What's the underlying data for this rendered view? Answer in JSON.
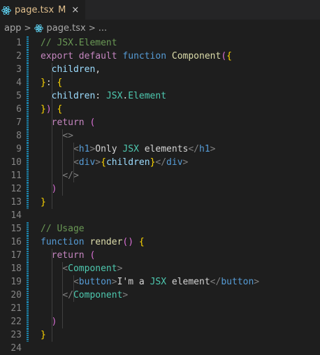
{
  "tab": {
    "filename": "page.tsx",
    "badge": "M",
    "close": "×",
    "icon": "react-icon"
  },
  "breadcrumb": {
    "segments": [
      "app",
      "page.tsx",
      "..."
    ],
    "separator": ">"
  },
  "editor": {
    "lines": [
      {
        "n": "1",
        "code": "// JSX.Element"
      },
      {
        "n": "2",
        "code": "export default function Component({"
      },
      {
        "n": "3",
        "code": "  children,"
      },
      {
        "n": "4",
        "code": "}: {"
      },
      {
        "n": "5",
        "code": "  children: JSX.Element"
      },
      {
        "n": "6",
        "code": "}) {"
      },
      {
        "n": "7",
        "code": "  return ("
      },
      {
        "n": "8",
        "code": "    <>"
      },
      {
        "n": "9",
        "code": "      <h1>Only JSX elements</h1>"
      },
      {
        "n": "10",
        "code": "      <div>{children}</div>"
      },
      {
        "n": "11",
        "code": "    </>"
      },
      {
        "n": "12",
        "code": "  )"
      },
      {
        "n": "13",
        "code": "}"
      },
      {
        "n": "14",
        "code": ""
      },
      {
        "n": "15",
        "code": "// Usage"
      },
      {
        "n": "16",
        "code": "function render() {"
      },
      {
        "n": "17",
        "code": "  return ("
      },
      {
        "n": "18",
        "code": "    <Component>"
      },
      {
        "n": "19",
        "code": "      <button>I'm a JSX element</button>"
      },
      {
        "n": "20",
        "code": "    </Component>"
      },
      {
        "n": "21",
        "code": ""
      },
      {
        "n": "22",
        "code": "  )"
      },
      {
        "n": "23",
        "code": "}"
      },
      {
        "n": "24",
        "code": ""
      }
    ]
  },
  "colors": {
    "background": "#1e1e1e",
    "tab_modified": "#e2c08d",
    "gutter_modified": "#1b81a8",
    "keyword": "#c586c0",
    "storage": "#569cd6",
    "function": "#dcdcaa",
    "type": "#4ec9b0",
    "comment": "#6a9955"
  }
}
